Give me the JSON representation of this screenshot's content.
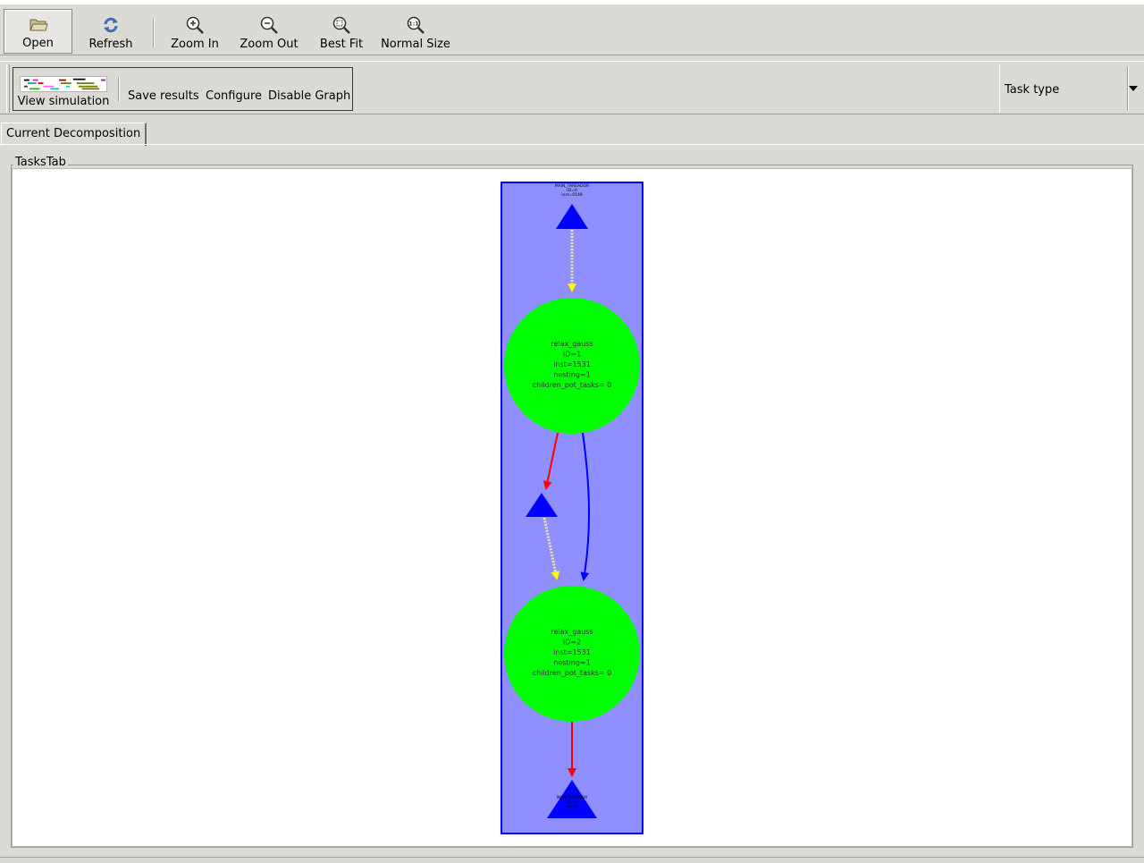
{
  "toolbar": {
    "open": {
      "label": "Open",
      "icon": "folder-open-icon"
    },
    "refresh": {
      "label": "Refresh",
      "icon": "refresh-icon"
    },
    "zoom_in": {
      "label": "Zoom In",
      "icon": "zoom-in-icon"
    },
    "zoom_out": {
      "label": "Zoom Out",
      "icon": "zoom-out-icon"
    },
    "best_fit": {
      "label": "Best Fit",
      "icon": "zoom-fit-icon"
    },
    "normal_size": {
      "label": "Normal Size",
      "icon": "zoom-100-icon"
    }
  },
  "simulation_bar": {
    "view_simulation": "View simulation",
    "save_results": "Save results",
    "configure": "Configure",
    "disable_graph": "Disable Graph",
    "task_type_selected": "Task type"
  },
  "tabs": [
    {
      "label": "Current Decomposition",
      "active": true
    }
  ],
  "group": {
    "title": "TasksTab"
  },
  "graph": {
    "start_node": {
      "lines": [
        "MAIN_TAREADOR",
        "ID=0",
        "inst=0148"
      ],
      "color": "#0000ff"
    },
    "task_nodes": [
      {
        "lines": [
          "relax_gauss",
          "ID=1",
          "inst=1531",
          "nesting=1",
          "children_pot_tasks= 0"
        ],
        "color": "#00ff00"
      },
      {
        "lines": [
          "relax_gauss",
          "ID=2",
          "inst=1531",
          "nesting=1",
          "children_pot_tasks= 0"
        ],
        "color": "#00ff00"
      }
    ],
    "end_node": {
      "lines": [
        "MAIN_TAREADOR",
        "ID=3",
        "inst=0"
      ],
      "color": "#0000ff"
    },
    "cluster_color": "#8f8fff",
    "cluster_border": "#0000ff",
    "edge_colors": {
      "true_dep": "#ff0000",
      "anti_dep": "#0000ff",
      "control": "#ffff00"
    }
  }
}
